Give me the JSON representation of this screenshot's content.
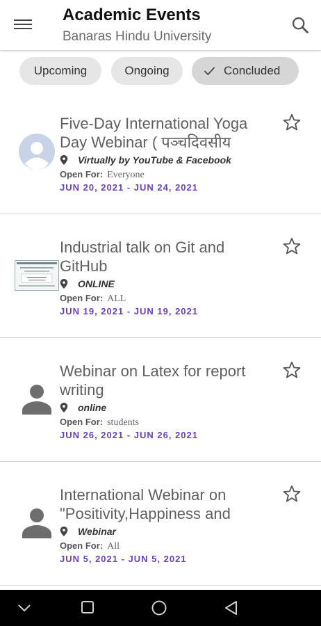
{
  "appbar": {
    "title": "Academic Events",
    "subtitle": "Banaras Hindu University",
    "menu_icon": "hamburger-menu-icon",
    "search_icon": "search-icon"
  },
  "filters": [
    {
      "label": "Upcoming",
      "selected": false
    },
    {
      "label": "Ongoing",
      "selected": false
    },
    {
      "label": "Concluded",
      "selected": true
    }
  ],
  "events": [
    {
      "title_line1": "Five-Day International Yoga",
      "title_line2": "Day Webinar ( पञ्चदिवसीय",
      "location": "Virtually by YouTube & Facebook",
      "open_for_label": "Open For:",
      "open_for": "Everyone",
      "dates": "JUN 20, 2021 - JUN 24, 2021",
      "thumb": "avatar-circle"
    },
    {
      "title_line1": "Industrial talk on Git and",
      "title_line2": "GitHub",
      "location": "ONLINE",
      "open_for_label": "Open For:",
      "open_for": "ALL",
      "dates": "JUN 19, 2021 - JUN 19, 2021",
      "thumb": "poster-image"
    },
    {
      "title_line1": "Webinar on Latex for report",
      "title_line2": "writing",
      "location": "online",
      "open_for_label": "Open For:",
      "open_for": "students",
      "dates": "JUN 26, 2021 - JUN 26, 2021",
      "thumb": "person"
    },
    {
      "title_line1": "International Webinar on",
      "title_line2": "\"Positivity,Happiness and",
      "location": "Webinar",
      "open_for_label": "Open For:",
      "open_for": "All",
      "dates": "JUN 5, 2021 - JUN 5, 2021",
      "thumb": "person"
    }
  ],
  "colors": {
    "accent": "#6a3fc2",
    "chip_bg": "#e6e6e6",
    "chip_selected_bg": "#d6d6d6",
    "nav_bar": "#000000"
  }
}
